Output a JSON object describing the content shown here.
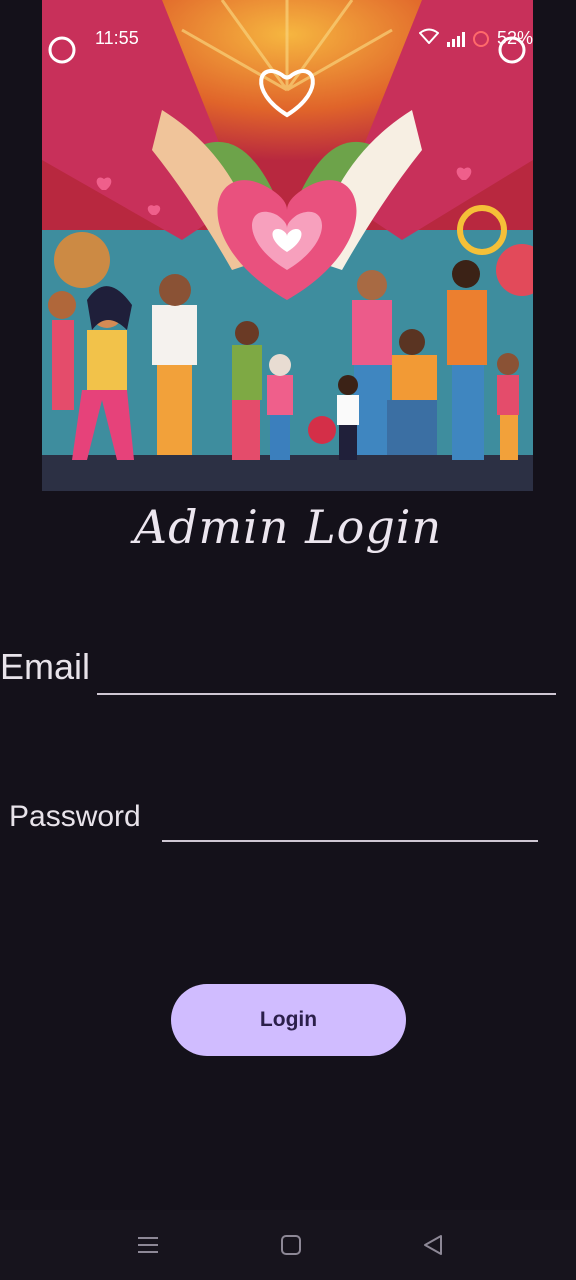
{
  "status_bar": {
    "time": "11:55",
    "battery": "52%"
  },
  "hero": {
    "description_icon": "community-heart-illustration"
  },
  "title": "Admin Login",
  "form": {
    "email_label": "Email",
    "email_value": "",
    "password_label": "Password",
    "password_value": "",
    "login_label": "Login"
  },
  "colors": {
    "background": "#14111a",
    "button": "#d0bcff",
    "button_text": "#2b1f4a"
  },
  "nav": {
    "menu_icon": "menu-icon",
    "home_icon": "home-icon",
    "back_icon": "back-icon"
  }
}
